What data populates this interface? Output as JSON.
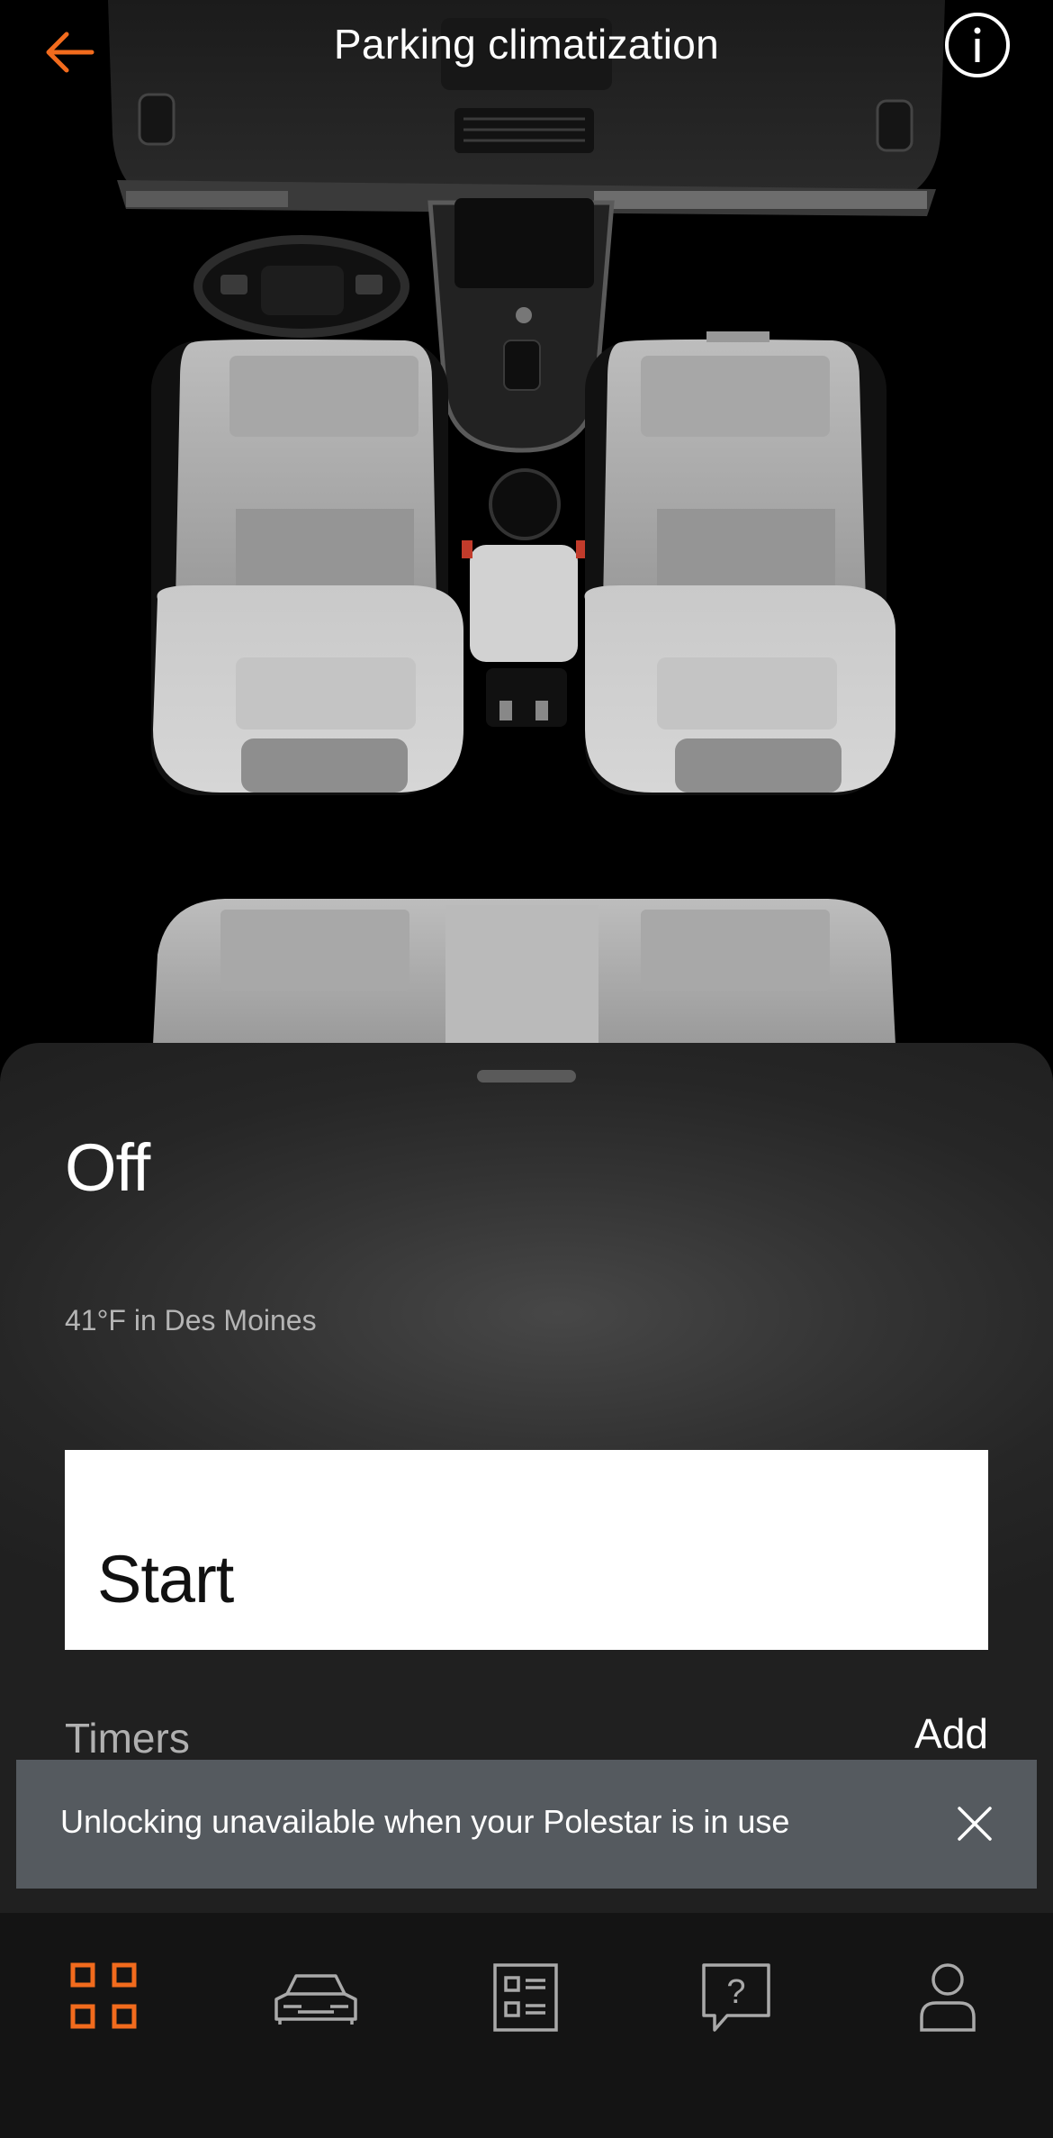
{
  "header": {
    "title": "Parking climatization",
    "back_icon": "arrow-left-icon",
    "info_icon": "info-circle-icon"
  },
  "colors": {
    "accent": "#F26B1D",
    "sheet_bg": "#2a2a2a",
    "toast_bg": "#555a5f",
    "nav_bg": "#141414",
    "start_button_bg": "#ffffff"
  },
  "climate": {
    "status": "Off",
    "weather": "41°F in Des Moines",
    "start_label": "Start",
    "timers_label": "Timers",
    "add_label": "Add"
  },
  "toast": {
    "message": "Unlocking unavailable when your Polestar is in use",
    "close_icon": "close-icon"
  },
  "nav": {
    "items": [
      {
        "name": "dashboard",
        "icon": "grid-icon",
        "active": true
      },
      {
        "name": "car",
        "icon": "car-icon",
        "active": false
      },
      {
        "name": "articles",
        "icon": "list-document-icon",
        "active": false
      },
      {
        "name": "support",
        "icon": "help-chat-icon",
        "active": false
      },
      {
        "name": "profile",
        "icon": "person-icon",
        "active": false
      }
    ]
  }
}
